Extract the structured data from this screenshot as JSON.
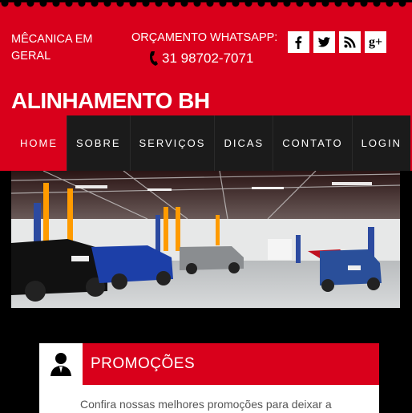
{
  "header": {
    "tagline": "MÊCANICA EM GERAL",
    "whatsapp_label": "ORÇAMENTO WHATSAPP:",
    "phone": "31 98702-7071",
    "brand": "ALINHAMENTO BH",
    "socials": [
      {
        "name": "facebook",
        "icon": "facebook-icon"
      },
      {
        "name": "twitter",
        "icon": "twitter-icon"
      },
      {
        "name": "rss",
        "icon": "rss-icon"
      },
      {
        "name": "google-plus",
        "icon": "google-plus-icon",
        "glyph": "g+"
      }
    ]
  },
  "nav": {
    "items": [
      {
        "label": "HOME",
        "active": true
      },
      {
        "label": "SOBRE"
      },
      {
        "label": "SERVIÇOS"
      },
      {
        "label": "DICAS"
      },
      {
        "label": "CONTATO"
      },
      {
        "label": "LOGIN"
      }
    ]
  },
  "promo": {
    "title": "PROMOÇÕES",
    "text": "Confira nossas melhores promoções para deixar a"
  },
  "colors": {
    "brand_red": "#d9001b",
    "nav_dark": "#1b1b1b",
    "background": "#000000"
  }
}
